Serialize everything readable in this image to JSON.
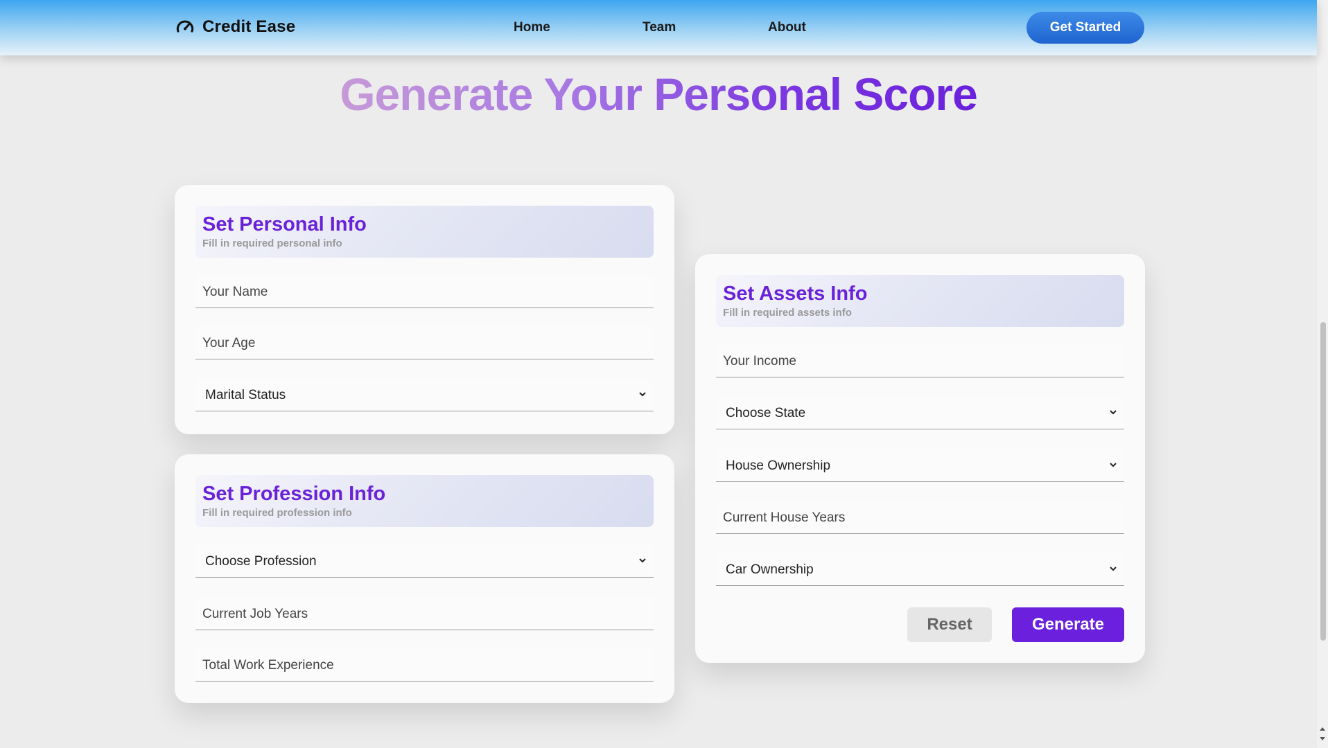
{
  "navbar": {
    "brand_name": "Credit Ease",
    "brand_icon": "speedometer-icon",
    "links": [
      {
        "label": "Home"
      },
      {
        "label": "Team"
      },
      {
        "label": "About"
      }
    ],
    "cta_label": "Get Started"
  },
  "page": {
    "title": "Generate Your Personal Score"
  },
  "personal": {
    "title": "Set Personal Info",
    "subtitle": "Fill in required personal info",
    "name_placeholder": "Your Name",
    "age_placeholder": "Your Age",
    "marital_status": "Marital Status"
  },
  "profession": {
    "title": "Set Profession Info",
    "subtitle": "Fill in required profession info",
    "profession_select": "Choose Profession",
    "job_years_placeholder": "Current Job Years",
    "work_experience_placeholder": "Total Work Experience"
  },
  "assets": {
    "title": "Set Assets Info",
    "subtitle": "Fill in required assets info",
    "income_placeholder": "Your Income",
    "state_select": "Choose State",
    "house_ownership_select": "House Ownership",
    "house_years_placeholder": "Current House Years",
    "car_ownership_select": "Car Ownership",
    "reset_label": "Reset",
    "generate_label": "Generate"
  },
  "colors": {
    "accent": "#6a20dc",
    "nav_gradient_top": "#3ea6ef",
    "cta": "#1f63cf"
  }
}
